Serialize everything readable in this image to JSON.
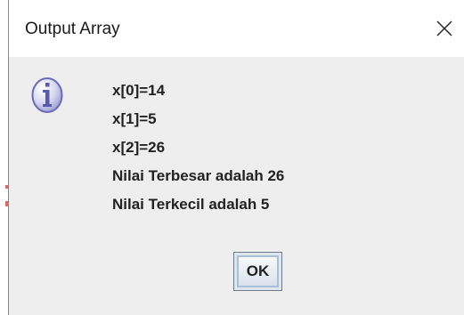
{
  "window": {
    "title": "Output Array"
  },
  "icons": {
    "message_icon": "information-icon",
    "close_icon": "close-icon"
  },
  "messages": [
    "x[0]=14",
    "x[1]=5",
    "x[2]=26",
    "Nilai Terbesar adalah 26",
    "Nilai Terkecil adalah 5"
  ],
  "buttons": {
    "ok_label": "OK"
  }
}
